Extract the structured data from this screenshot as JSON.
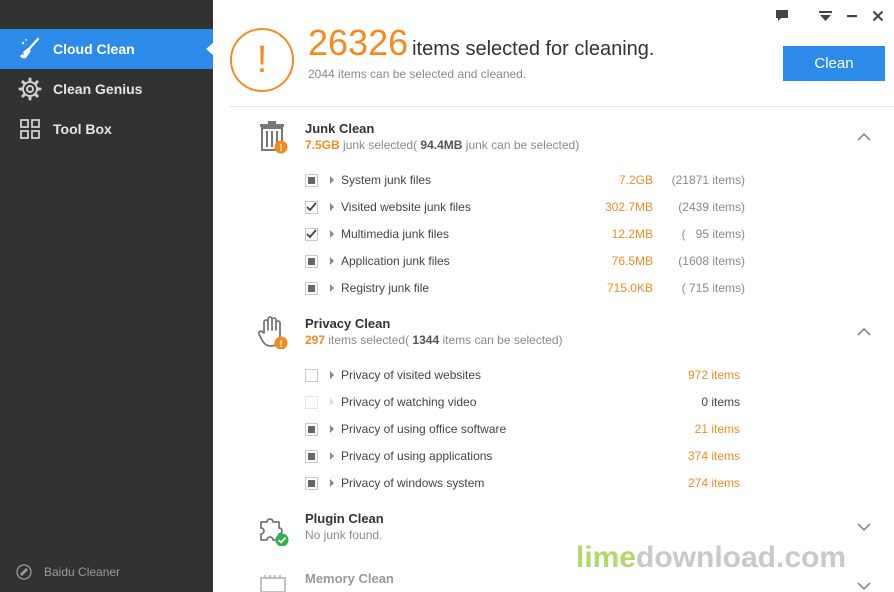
{
  "sidebar": {
    "items": [
      {
        "label": "Cloud Clean",
        "icon": "broom-icon",
        "active": true
      },
      {
        "label": "Clean Genius",
        "icon": "gear-icon",
        "active": false
      },
      {
        "label": "Tool Box",
        "icon": "grid-icon",
        "active": false
      }
    ],
    "brand": "Baidu Cleaner"
  },
  "header": {
    "count": "26326",
    "headline": "items selected for cleaning.",
    "sub_count": "2044",
    "sub_text": "items can be selected and cleaned.",
    "clean_label": "Clean",
    "alert_symbol": "!"
  },
  "junk": {
    "title": "Junk Clean",
    "selected": "7.5GB",
    "mid_text": "junk selected(",
    "total": "94.4MB",
    "end_text": "junk can be selected)",
    "rows": [
      {
        "label": "System junk files",
        "size": "7.2GB",
        "count": "(21871 items)",
        "state": "partial"
      },
      {
        "label": "Visited website junk files",
        "size": "302.7MB",
        "count": "(2439 items)",
        "state": "checked"
      },
      {
        "label": "Multimedia junk files",
        "size": "12.2MB",
        "count": "(   95 items)",
        "state": "checked"
      },
      {
        "label": "Application junk files",
        "size": "76.5MB",
        "count": "(1608 items)",
        "state": "partial"
      },
      {
        "label": "Registry junk file",
        "size": "715.0KB",
        "count": "( 715 items)",
        "state": "partial"
      }
    ]
  },
  "privacy": {
    "title": "Privacy Clean",
    "selected": "297",
    "mid_text": "items selected(",
    "total": "1344",
    "end_text": "items can be selected)",
    "rows": [
      {
        "label": "Privacy of visited websites",
        "items": "972 items",
        "state": "unchecked"
      },
      {
        "label": "Privacy of watching video",
        "items": "0 items",
        "state": "disabled"
      },
      {
        "label": "Privacy of using office software",
        "items": "21 items",
        "state": "partial"
      },
      {
        "label": "Privacy of using applications",
        "items": "374 items",
        "state": "partial"
      },
      {
        "label": "Privacy of windows system",
        "items": "274 items",
        "state": "partial"
      }
    ]
  },
  "plugin": {
    "title": "Plugin Clean",
    "status": "No junk found."
  },
  "memory": {
    "title": "Memory Clean"
  },
  "watermark": {
    "part_a": "lime",
    "part_b": "download.com"
  },
  "colors": {
    "accent_blue": "#2c8ae8",
    "accent_orange": "#f58a1f",
    "sidebar_bg": "#323232",
    "success_green": "#2bb24c"
  }
}
